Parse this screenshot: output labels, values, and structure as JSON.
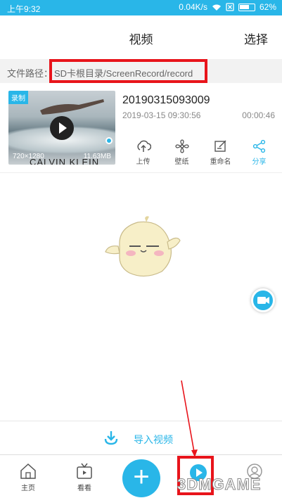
{
  "status_bar": {
    "time": "上午9:32",
    "speed": "0.04K/s",
    "battery": "62%"
  },
  "header": {
    "title": "视频",
    "select_label": "选择"
  },
  "path": {
    "label": "文件路径：",
    "value": "SD卡根目录/ScreenRecord/record"
  },
  "video": {
    "tag": "录制",
    "resolution": "720×1280",
    "size": "11.63MB",
    "thumbnail_text": "CALVIN KLEIN",
    "name": "20190315093009",
    "date": "2019-03-15 09:30:56",
    "duration": "00:00:46",
    "actions": [
      {
        "label": "上传",
        "icon": "upload-icon"
      },
      {
        "label": "壁纸",
        "icon": "fan-icon"
      },
      {
        "label": "重命名",
        "icon": "edit-icon"
      },
      {
        "label": "分享",
        "icon": "share-icon"
      }
    ]
  },
  "import": {
    "label": "导入视频"
  },
  "tabs": [
    {
      "label": "主页",
      "icon": "home-icon"
    },
    {
      "label": "看看",
      "icon": "tv-icon"
    },
    {
      "label": "",
      "icon": "play-icon"
    },
    {
      "label": "",
      "icon": "profile-icon"
    }
  ],
  "watermark": "3DMGAME",
  "colors": {
    "accent": "#29b6e8",
    "highlight": "#e8141b"
  }
}
